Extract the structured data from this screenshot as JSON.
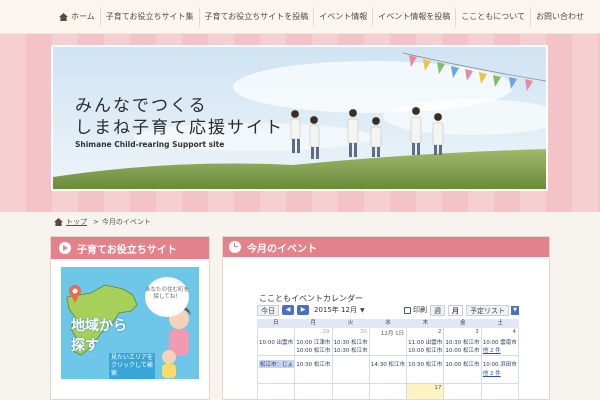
{
  "nav": {
    "items": [
      {
        "label": "ホーム"
      },
      {
        "label": "子育てお役立ちサイト集"
      },
      {
        "label": "子育てお役立ちサイトを投稿"
      },
      {
        "label": "イベント情報"
      },
      {
        "label": "イベント情報を投稿"
      },
      {
        "label": "ここともについて"
      },
      {
        "label": "お問い合わせ"
      }
    ]
  },
  "hero": {
    "title_line1": "みんなでつくる",
    "title_line2": "しまね子育て応援サイト",
    "subtitle": "Shimane Child-rearing Support site"
  },
  "breadcrumb": {
    "home": "トップ",
    "separator": ">",
    "current": "今月のイベント"
  },
  "left_panel": {
    "title": "子育てお役立ちサイト",
    "promo": {
      "headline1": "地域から",
      "headline2": "探す",
      "caption": "見たいエリアをクリックして検索",
      "bubble": "あなたの住む町を探してね！"
    }
  },
  "right_panel": {
    "title": "今月のイベント",
    "calendar": {
      "title": "ここともイベントカレンダー",
      "today_label": "今日",
      "prev_arrow": "◀",
      "next_arrow": "▶",
      "month_label": "2015年 12月",
      "caret": "▼",
      "print_label": "印刷",
      "tabs": [
        "週",
        "月",
        "予定リスト"
      ],
      "active_tab": "月",
      "dropdown": "▼",
      "weekdays": [
        "日",
        "月",
        "火",
        "水",
        "木",
        "金",
        "土"
      ],
      "week1": [
        {
          "day": "",
          "muted": true
        },
        {
          "day": "29",
          "muted": true
        },
        {
          "day": "30",
          "muted": true
        },
        {
          "day": "12月 1日",
          "muted": false
        },
        {
          "day": "2",
          "muted": false
        },
        {
          "day": "3",
          "muted": false
        },
        {
          "day": "4",
          "muted": false
        }
      ],
      "week1_events": [
        {
          "text": "10:00 出雲市"
        },
        {
          "text": "10:00 江津市"
        },
        {
          "text": "10:30 松江市"
        },
        {
          "text": ""
        },
        {
          "text": "11:00 出雲市"
        },
        {
          "text": "10:30 松江市"
        },
        {
          "text": "10:00 雲南市"
        }
      ],
      "week1_events2": [
        {
          "text": ""
        },
        {
          "text": "10:00 松江市"
        },
        {
          "text": "10:30 松江市"
        },
        {
          "text": ""
        },
        {
          "text": "10:00 松江市"
        },
        {
          "text": "10:00 松江市"
        },
        {
          "text": "他 2 件"
        }
      ],
      "week2_events": [
        {
          "text": "松江市：じょ",
          "chip": true
        },
        {
          "text": "10:30 松江市"
        },
        {
          "text": ""
        },
        {
          "text": "14:30 松江市"
        },
        {
          "text": "10:30 松江市"
        },
        {
          "text": "10:00 松江市"
        },
        {
          "text": "10:00 浜田市"
        }
      ],
      "week2_events2": [
        {
          "text": ""
        },
        {
          "text": ""
        },
        {
          "text": ""
        },
        {
          "text": ""
        },
        {
          "text": ""
        },
        {
          "text": ""
        },
        {
          "text": "他 2 件"
        }
      ],
      "week3": [
        {
          "day": ""
        },
        {
          "day": ""
        },
        {
          "day": ""
        },
        {
          "day": ""
        },
        {
          "day": "17"
        },
        {
          "day": ""
        },
        {
          "day": ""
        }
      ]
    }
  },
  "colors": {
    "accent_pink": "#e4828b",
    "banner_pink": "#f6cfd2",
    "calendar_blue": "#4a6fc4",
    "today_yellow": "#fff3c4"
  }
}
